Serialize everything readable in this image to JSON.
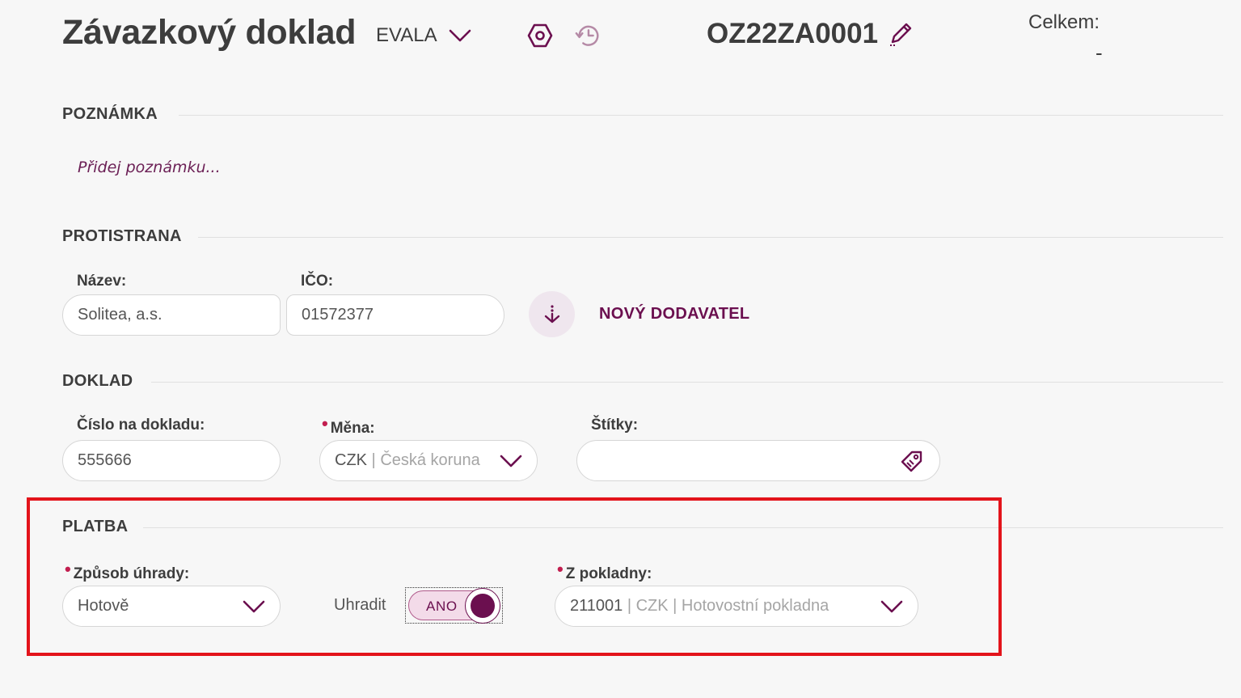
{
  "header": {
    "title": "Závazkový doklad",
    "company": "EVALA",
    "document_number": "OZ22ZA0001",
    "total_label": "Celkem:",
    "total_value": "-"
  },
  "note_section": {
    "title": "POZNÁMKA",
    "placeholder": "Přidej poznámku..."
  },
  "counterparty": {
    "title": "PROTISTRANA",
    "name_label": "Název:",
    "name_value": "Solitea, a.s.",
    "ico_label": "IČO:",
    "ico_value": "01572377",
    "new_supplier_label": "NOVÝ DODAVATEL"
  },
  "document": {
    "title": "DOKLAD",
    "doc_number_label": "Číslo na dokladu:",
    "doc_number_value": "555666",
    "currency_label": "Měna:",
    "currency_code": "CZK",
    "currency_separator": " | ",
    "currency_name": "Česká koruna",
    "tags_label": "Štítky:",
    "tags_value": ""
  },
  "payment": {
    "title": "PLATBA",
    "method_label": "Způsob úhrady:",
    "method_value": "Hotově",
    "pay_label": "Uhradit",
    "pay_toggle_text": "ANO",
    "pay_toggle_on": true,
    "cashbox_label": "Z pokladny:",
    "cashbox_code": "211001",
    "cashbox_rest": " | CZK | Hotovostní pokladna"
  },
  "colors": {
    "accent": "#6b0f4f",
    "required": "#c21e4f",
    "highlight": "#e3141b"
  }
}
